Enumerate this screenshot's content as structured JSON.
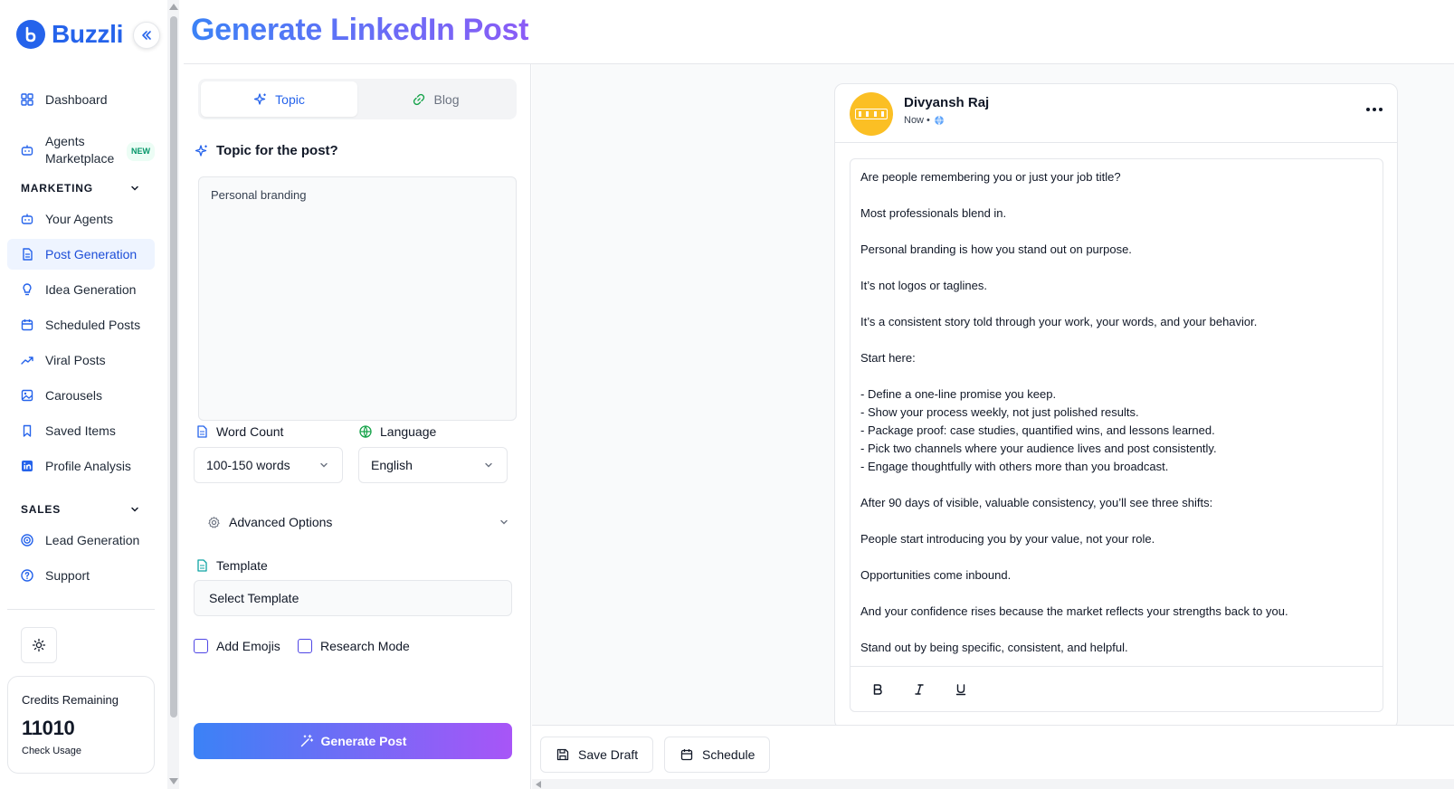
{
  "brand": {
    "name": "Buzzli",
    "color": "#2563eb"
  },
  "sidebar": {
    "items_top": [
      {
        "label": "Dashboard",
        "icon": "grid-icon"
      },
      {
        "label": "Agents Marketplace",
        "line1": "Agents",
        "line2": "Marketplace",
        "badge": "NEW",
        "icon": "bot-icon"
      }
    ],
    "marketing_label": "MARKETING",
    "marketing_items": [
      {
        "label": "Your Agents",
        "icon": "bot-icon"
      },
      {
        "label": "Post Generation",
        "icon": "document-icon",
        "active": true
      },
      {
        "label": "Idea Generation",
        "icon": "lightbulb-icon"
      },
      {
        "label": "Scheduled Posts",
        "icon": "calendar-icon"
      },
      {
        "label": "Viral Posts",
        "icon": "trending-icon"
      },
      {
        "label": "Carousels",
        "icon": "image-icon"
      },
      {
        "label": "Saved Items",
        "icon": "bookmark-icon"
      },
      {
        "label": "Profile Analysis",
        "icon": "linkedin-icon"
      }
    ],
    "sales_label": "SALES",
    "sales_items": [
      {
        "label": "Lead Generation",
        "icon": "target-icon"
      },
      {
        "label": "Support",
        "icon": "help-circle-icon"
      }
    ],
    "credits": {
      "label": "Credits Remaining",
      "value": "11010",
      "link": "Check Usage"
    }
  },
  "header": {
    "title": "Generate LinkedIn Post"
  },
  "form": {
    "tabs": [
      {
        "label": "Topic",
        "active": true
      },
      {
        "label": "Blog",
        "active": false
      }
    ],
    "topic_label": "Topic for the post?",
    "topic_value": "Personal branding",
    "word_count_label": "Word Count",
    "word_count_value": "100-150 words",
    "language_label": "Language",
    "language_value": "English",
    "advanced_label": "Advanced Options",
    "template_label": "Template",
    "template_value": "Select Template",
    "emojis_label": "Add Emojis",
    "research_label": "Research Mode",
    "generate_label": "Generate Post"
  },
  "preview": {
    "author": "Divyansh Raj",
    "time": "Now •",
    "avatar_color": "#fbbf24",
    "lines": [
      {
        "text": "Are people remembering you or just your job title?",
        "gap": true
      },
      {
        "text": "Most professionals blend in.",
        "gap": true
      },
      {
        "text": "Personal branding is how you stand out on purpose.",
        "gap": true
      },
      {
        "text": "It’s not logos or taglines.",
        "gap": true
      },
      {
        "text": "It’s a consistent story told through your work, your words, and your behavior.",
        "gap": true
      },
      {
        "text": "Start here:",
        "gap": true
      },
      {
        "text": "- Define a one-line promise you keep.",
        "gap": false
      },
      {
        "text": "- Show your process weekly, not just polished results.",
        "gap": false
      },
      {
        "text": "- Package proof: case studies, quantified wins, and lessons learned.",
        "gap": false
      },
      {
        "text": "- Pick two channels where your audience lives and post consistently.",
        "gap": false
      },
      {
        "text": "- Engage thoughtfully with others more than you broadcast.",
        "gap": true
      },
      {
        "text": "After 90 days of visible, valuable consistency, you’ll see three shifts:",
        "gap": true
      },
      {
        "text": "People start introducing you by your value, not your role.",
        "gap": true
      },
      {
        "text": "Opportunities come inbound.",
        "gap": true
      },
      {
        "text": "And your confidence rises because the market reflects your strengths back to you.",
        "gap": true
      },
      {
        "text": "Stand out by being specific, consistent, and helpful.",
        "gap": false
      }
    ],
    "save_draft_label": "Save Draft",
    "schedule_label": "Schedule"
  }
}
